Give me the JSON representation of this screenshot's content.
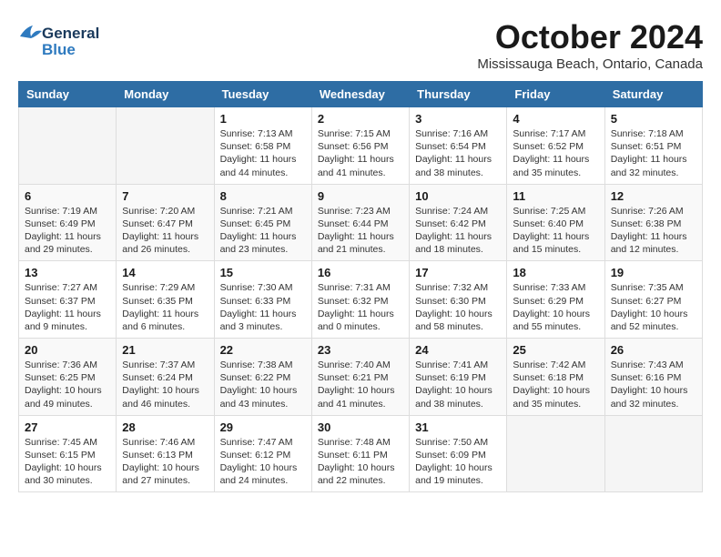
{
  "header": {
    "logo_general": "General",
    "logo_blue": "Blue",
    "month": "October 2024",
    "location": "Mississauga Beach, Ontario, Canada"
  },
  "days_of_week": [
    "Sunday",
    "Monday",
    "Tuesday",
    "Wednesday",
    "Thursday",
    "Friday",
    "Saturday"
  ],
  "weeks": [
    [
      {
        "day": "",
        "sunrise": "",
        "sunset": "",
        "daylight": ""
      },
      {
        "day": "",
        "sunrise": "",
        "sunset": "",
        "daylight": ""
      },
      {
        "day": "1",
        "sunrise": "Sunrise: 7:13 AM",
        "sunset": "Sunset: 6:58 PM",
        "daylight": "Daylight: 11 hours and 44 minutes."
      },
      {
        "day": "2",
        "sunrise": "Sunrise: 7:15 AM",
        "sunset": "Sunset: 6:56 PM",
        "daylight": "Daylight: 11 hours and 41 minutes."
      },
      {
        "day": "3",
        "sunrise": "Sunrise: 7:16 AM",
        "sunset": "Sunset: 6:54 PM",
        "daylight": "Daylight: 11 hours and 38 minutes."
      },
      {
        "day": "4",
        "sunrise": "Sunrise: 7:17 AM",
        "sunset": "Sunset: 6:52 PM",
        "daylight": "Daylight: 11 hours and 35 minutes."
      },
      {
        "day": "5",
        "sunrise": "Sunrise: 7:18 AM",
        "sunset": "Sunset: 6:51 PM",
        "daylight": "Daylight: 11 hours and 32 minutes."
      }
    ],
    [
      {
        "day": "6",
        "sunrise": "Sunrise: 7:19 AM",
        "sunset": "Sunset: 6:49 PM",
        "daylight": "Daylight: 11 hours and 29 minutes."
      },
      {
        "day": "7",
        "sunrise": "Sunrise: 7:20 AM",
        "sunset": "Sunset: 6:47 PM",
        "daylight": "Daylight: 11 hours and 26 minutes."
      },
      {
        "day": "8",
        "sunrise": "Sunrise: 7:21 AM",
        "sunset": "Sunset: 6:45 PM",
        "daylight": "Daylight: 11 hours and 23 minutes."
      },
      {
        "day": "9",
        "sunrise": "Sunrise: 7:23 AM",
        "sunset": "Sunset: 6:44 PM",
        "daylight": "Daylight: 11 hours and 21 minutes."
      },
      {
        "day": "10",
        "sunrise": "Sunrise: 7:24 AM",
        "sunset": "Sunset: 6:42 PM",
        "daylight": "Daylight: 11 hours and 18 minutes."
      },
      {
        "day": "11",
        "sunrise": "Sunrise: 7:25 AM",
        "sunset": "Sunset: 6:40 PM",
        "daylight": "Daylight: 11 hours and 15 minutes."
      },
      {
        "day": "12",
        "sunrise": "Sunrise: 7:26 AM",
        "sunset": "Sunset: 6:38 PM",
        "daylight": "Daylight: 11 hours and 12 minutes."
      }
    ],
    [
      {
        "day": "13",
        "sunrise": "Sunrise: 7:27 AM",
        "sunset": "Sunset: 6:37 PM",
        "daylight": "Daylight: 11 hours and 9 minutes."
      },
      {
        "day": "14",
        "sunrise": "Sunrise: 7:29 AM",
        "sunset": "Sunset: 6:35 PM",
        "daylight": "Daylight: 11 hours and 6 minutes."
      },
      {
        "day": "15",
        "sunrise": "Sunrise: 7:30 AM",
        "sunset": "Sunset: 6:33 PM",
        "daylight": "Daylight: 11 hours and 3 minutes."
      },
      {
        "day": "16",
        "sunrise": "Sunrise: 7:31 AM",
        "sunset": "Sunset: 6:32 PM",
        "daylight": "Daylight: 11 hours and 0 minutes."
      },
      {
        "day": "17",
        "sunrise": "Sunrise: 7:32 AM",
        "sunset": "Sunset: 6:30 PM",
        "daylight": "Daylight: 10 hours and 58 minutes."
      },
      {
        "day": "18",
        "sunrise": "Sunrise: 7:33 AM",
        "sunset": "Sunset: 6:29 PM",
        "daylight": "Daylight: 10 hours and 55 minutes."
      },
      {
        "day": "19",
        "sunrise": "Sunrise: 7:35 AM",
        "sunset": "Sunset: 6:27 PM",
        "daylight": "Daylight: 10 hours and 52 minutes."
      }
    ],
    [
      {
        "day": "20",
        "sunrise": "Sunrise: 7:36 AM",
        "sunset": "Sunset: 6:25 PM",
        "daylight": "Daylight: 10 hours and 49 minutes."
      },
      {
        "day": "21",
        "sunrise": "Sunrise: 7:37 AM",
        "sunset": "Sunset: 6:24 PM",
        "daylight": "Daylight: 10 hours and 46 minutes."
      },
      {
        "day": "22",
        "sunrise": "Sunrise: 7:38 AM",
        "sunset": "Sunset: 6:22 PM",
        "daylight": "Daylight: 10 hours and 43 minutes."
      },
      {
        "day": "23",
        "sunrise": "Sunrise: 7:40 AM",
        "sunset": "Sunset: 6:21 PM",
        "daylight": "Daylight: 10 hours and 41 minutes."
      },
      {
        "day": "24",
        "sunrise": "Sunrise: 7:41 AM",
        "sunset": "Sunset: 6:19 PM",
        "daylight": "Daylight: 10 hours and 38 minutes."
      },
      {
        "day": "25",
        "sunrise": "Sunrise: 7:42 AM",
        "sunset": "Sunset: 6:18 PM",
        "daylight": "Daylight: 10 hours and 35 minutes."
      },
      {
        "day": "26",
        "sunrise": "Sunrise: 7:43 AM",
        "sunset": "Sunset: 6:16 PM",
        "daylight": "Daylight: 10 hours and 32 minutes."
      }
    ],
    [
      {
        "day": "27",
        "sunrise": "Sunrise: 7:45 AM",
        "sunset": "Sunset: 6:15 PM",
        "daylight": "Daylight: 10 hours and 30 minutes."
      },
      {
        "day": "28",
        "sunrise": "Sunrise: 7:46 AM",
        "sunset": "Sunset: 6:13 PM",
        "daylight": "Daylight: 10 hours and 27 minutes."
      },
      {
        "day": "29",
        "sunrise": "Sunrise: 7:47 AM",
        "sunset": "Sunset: 6:12 PM",
        "daylight": "Daylight: 10 hours and 24 minutes."
      },
      {
        "day": "30",
        "sunrise": "Sunrise: 7:48 AM",
        "sunset": "Sunset: 6:11 PM",
        "daylight": "Daylight: 10 hours and 22 minutes."
      },
      {
        "day": "31",
        "sunrise": "Sunrise: 7:50 AM",
        "sunset": "Sunset: 6:09 PM",
        "daylight": "Daylight: 10 hours and 19 minutes."
      },
      {
        "day": "",
        "sunrise": "",
        "sunset": "",
        "daylight": ""
      },
      {
        "day": "",
        "sunrise": "",
        "sunset": "",
        "daylight": ""
      }
    ]
  ]
}
